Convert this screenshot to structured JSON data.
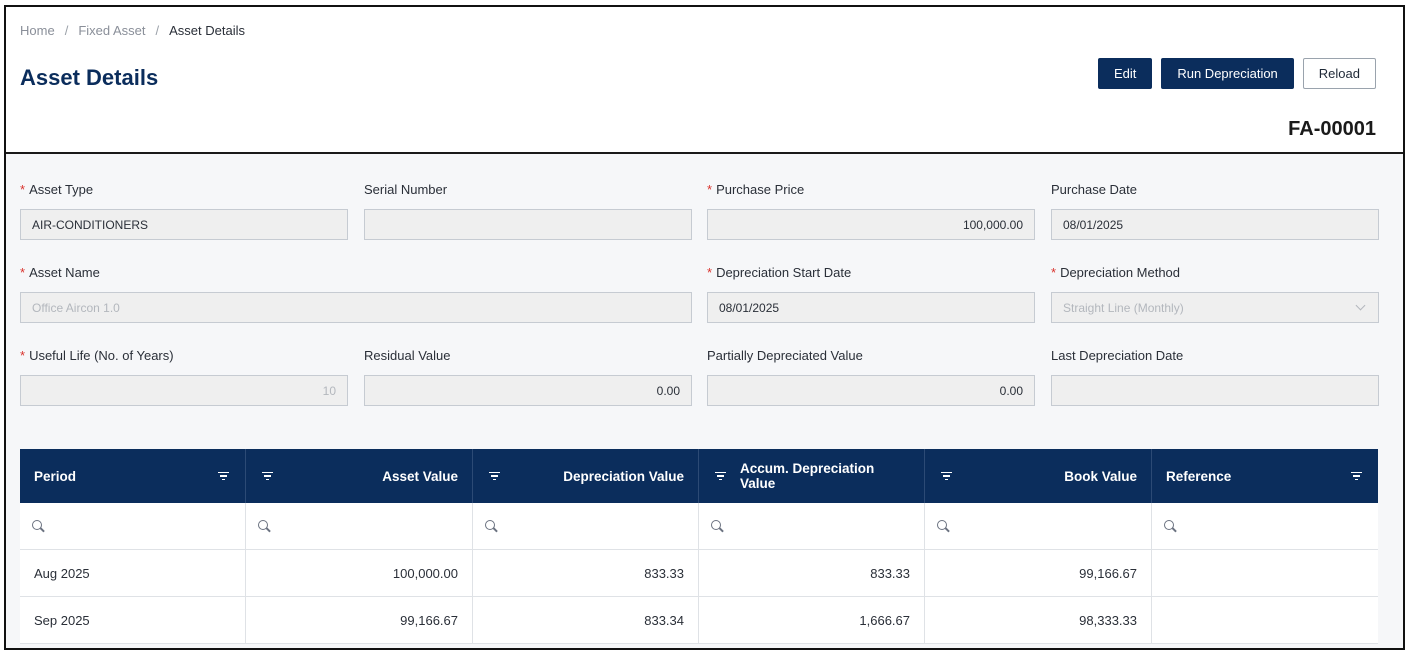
{
  "breadcrumb": {
    "home": "Home",
    "section": "Fixed Asset",
    "current": "Asset Details",
    "separator": "/"
  },
  "page": {
    "title": "Asset Details",
    "asset_code": "FA-00001"
  },
  "actions": {
    "edit": "Edit",
    "run_depreciation": "Run Depreciation",
    "reload": "Reload"
  },
  "form": {
    "asset_type": {
      "label": "Asset Type",
      "required": true,
      "value": "AIR-CONDITIONERS"
    },
    "serial_number": {
      "label": "Serial Number",
      "value": ""
    },
    "purchase_price": {
      "label": "Purchase Price",
      "required": true,
      "value": "100,000.00"
    },
    "purchase_date": {
      "label": "Purchase Date",
      "value": "08/01/2025"
    },
    "asset_name": {
      "label": "Asset Name",
      "required": true,
      "value": "Office Aircon 1.0"
    },
    "depreciation_start_date": {
      "label": "Depreciation Start Date",
      "required": true,
      "value": "08/01/2025"
    },
    "depreciation_method": {
      "label": "Depreciation Method",
      "required": true,
      "value": "Straight Line (Monthly)"
    },
    "useful_life": {
      "label": "Useful Life (No. of Years)",
      "required": true,
      "value": "10"
    },
    "residual_value": {
      "label": "Residual Value",
      "value": "0.00"
    },
    "partially_depreciated_value": {
      "label": "Partially Depreciated Value",
      "value": "0.00"
    },
    "last_depreciation_date": {
      "label": "Last Depreciation Date",
      "value": ""
    },
    "required_marker": "*"
  },
  "grid": {
    "columns": [
      "Period",
      "Asset Value",
      "Depreciation Value",
      "Accum. Depreciation Value",
      "Book Value",
      "Reference"
    ],
    "rows": [
      [
        "Aug 2025",
        "100,000.00",
        "833.33",
        "833.33",
        "99,166.67",
        ""
      ],
      [
        "Sep 2025",
        "99,166.67",
        "833.34",
        "1,666.67",
        "98,333.33",
        ""
      ]
    ]
  },
  "colors": {
    "primary": "#0b2d5c",
    "required": "#d9322c",
    "input_bg": "#efefef"
  },
  "icons": {
    "filter": "filter-icon",
    "search": "search-icon",
    "chevron": "chevron-down-icon"
  }
}
